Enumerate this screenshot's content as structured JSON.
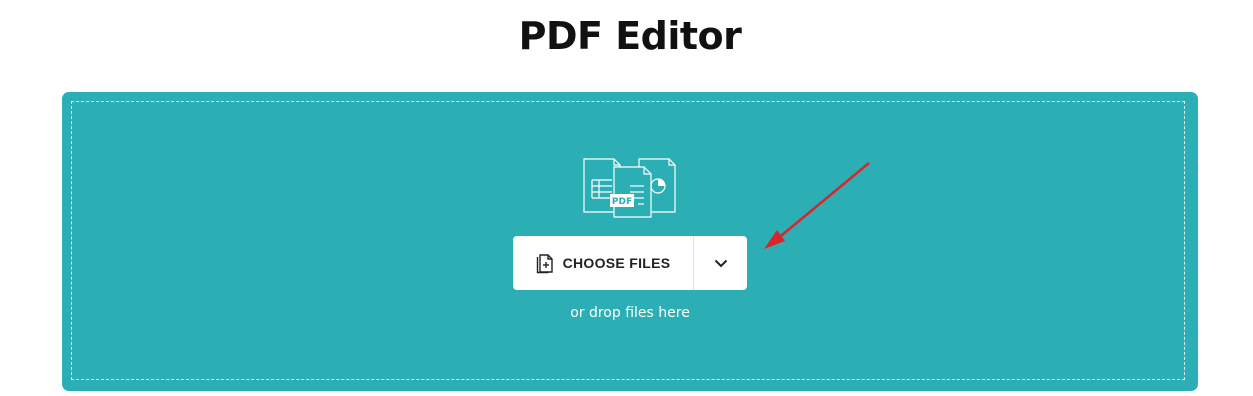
{
  "page": {
    "title": "PDF Editor"
  },
  "upload": {
    "choose_label": "CHOOSE FILES",
    "drop_hint": "or drop files here",
    "illustration_badge": "PDF"
  },
  "icons": {
    "file_add": "file-plus-icon",
    "dropdown": "chevron-down-icon",
    "illustration": "documents-illustration-icon"
  },
  "colors": {
    "panel": "#2bafb5",
    "button_bg": "#ffffff",
    "annotation_arrow": "#d9262b"
  }
}
